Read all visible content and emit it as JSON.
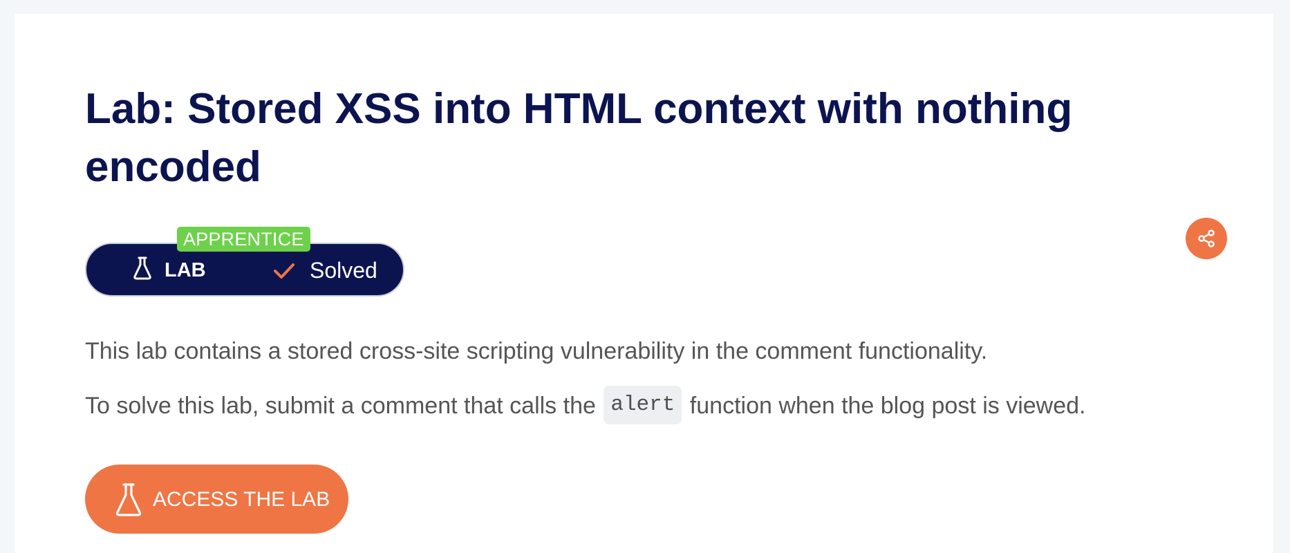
{
  "lab": {
    "title": "Lab: Stored XSS into HTML context with nothing encoded",
    "level": "APPRENTICE",
    "type_label": "LAB",
    "status_label": "Solved",
    "description": "This lab contains a stored cross-site scripting vulnerability in the comment functionality.",
    "instruction_before": "To solve this lab, submit a comment that calls the ",
    "instruction_code": "alert",
    "instruction_after": " function when the blog post is viewed.",
    "access_button": "ACCESS THE LAB"
  },
  "icons": {
    "lab": "flask-icon",
    "status": "check-icon",
    "share": "share-icon",
    "access": "flask-icon"
  },
  "colors": {
    "navy": "#0c1450",
    "orange": "#ef7545",
    "green": "#6ed14b",
    "text_muted": "#555555"
  }
}
